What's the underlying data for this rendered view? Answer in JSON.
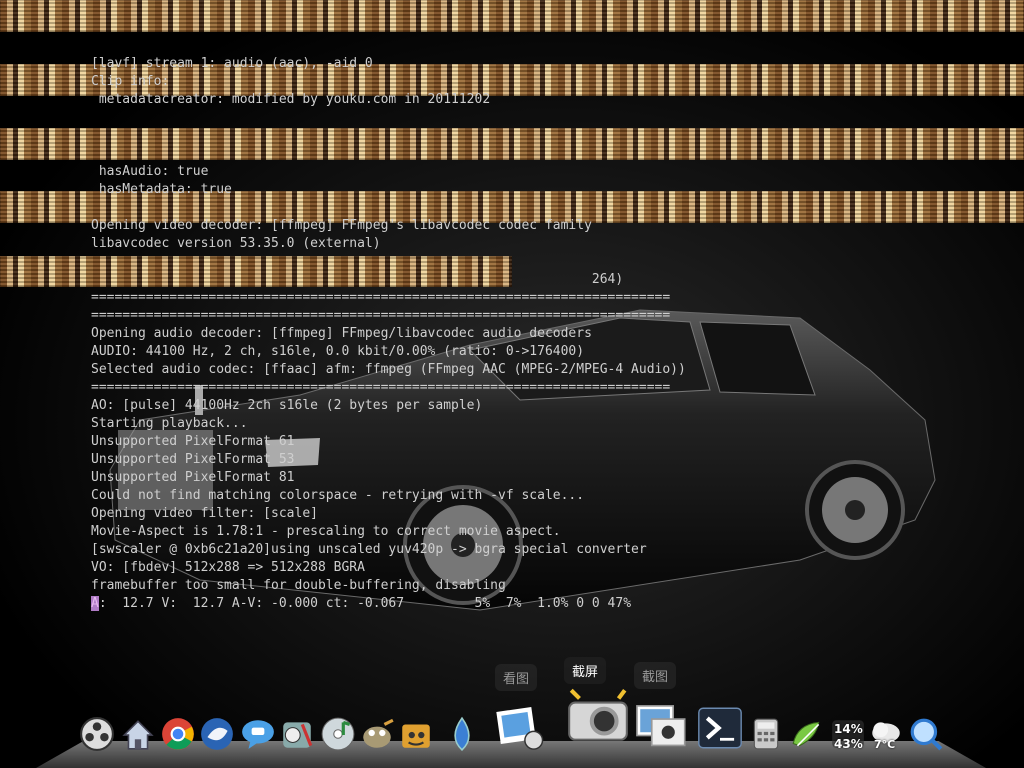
{
  "console": {
    "lines": [
      "[lavf] stream 1: audio (aac), -aid 0",
      "Clip info:",
      " metadatacreator: modified by youku.com in 20111202",
      "",
      "",
      "",
      " hasAudio: true",
      " hasMetadata: true",
      "",
      "Opening video decoder: [ffmpeg] FFmpeg's libavcodec codec family",
      "libavcodec version 53.35.0 (external)",
      "",
      "                                                                264)",
      "==========================================================================",
      "==========================================================================",
      "Opening audio decoder: [ffmpeg] FFmpeg/libavcodec audio decoders",
      "AUDIO: 44100 Hz, 2 ch, s16le, 0.0 kbit/0.00% (ratio: 0->176400)",
      "Selected audio codec: [ffaac] afm: ffmpeg (FFmpeg AAC (MPEG-2/MPEG-4 Audio))",
      "==========================================================================",
      "AO: [pulse] 44100Hz 2ch s16le (2 bytes per sample)",
      "Starting playback...",
      "Unsupported PixelFormat 61",
      "Unsupported PixelFormat 53",
      "Unsupported PixelFormat 81",
      "Could not find matching colorspace - retrying with -vf scale...",
      "Opening video filter: [scale]",
      "Movie-Aspect is 1.78:1 - prescaling to correct movie aspect.",
      "[swscaler @ 0xb6c21a20]using unscaled yuv420p -> bgra special converter",
      "VO: [fbdev] 512x288 => 512x288 BGRA",
      "framebuffer too small for double-buffering, disabling"
    ],
    "status_cursor": "A",
    "status_rest": ":  12.7 V:  12.7 A-V: -0.000 ct: -0.067         5%  7%  1.0% 0 0 47%"
  },
  "dock": {
    "tooltips": {
      "left": "看图",
      "center": "截屏",
      "right": "截图"
    },
    "items": [
      {
        "name": "film-reel-icon"
      },
      {
        "name": "home-icon"
      },
      {
        "name": "chrome-icon"
      },
      {
        "name": "thunderbird-icon"
      },
      {
        "name": "chat-bubble-icon"
      },
      {
        "name": "media-tools-icon"
      },
      {
        "name": "music-cd-icon"
      },
      {
        "name": "gimp-icon"
      },
      {
        "name": "terminal-duck-icon"
      },
      {
        "name": "water-drop-icon"
      },
      {
        "name": "photo-viewer-icon"
      },
      {
        "name": "screenshot-camera-icon"
      },
      {
        "name": "photo-frames-icon"
      },
      {
        "name": "terminal-icon"
      },
      {
        "name": "calculator-icon"
      },
      {
        "name": "text-editor-icon"
      },
      {
        "name": "system-monitor-icon"
      },
      {
        "name": "weather-icon"
      },
      {
        "name": "search-icon"
      }
    ],
    "monitor": {
      "cpu": "14%",
      "mem": "43%"
    },
    "weather": {
      "temp": "7°C"
    }
  },
  "colors": {
    "console_text": "#cfcfcf",
    "cursor_bg": "#b07cc6",
    "glitch_dark": "#7a4a1e",
    "glitch_light": "#d7b07a"
  }
}
